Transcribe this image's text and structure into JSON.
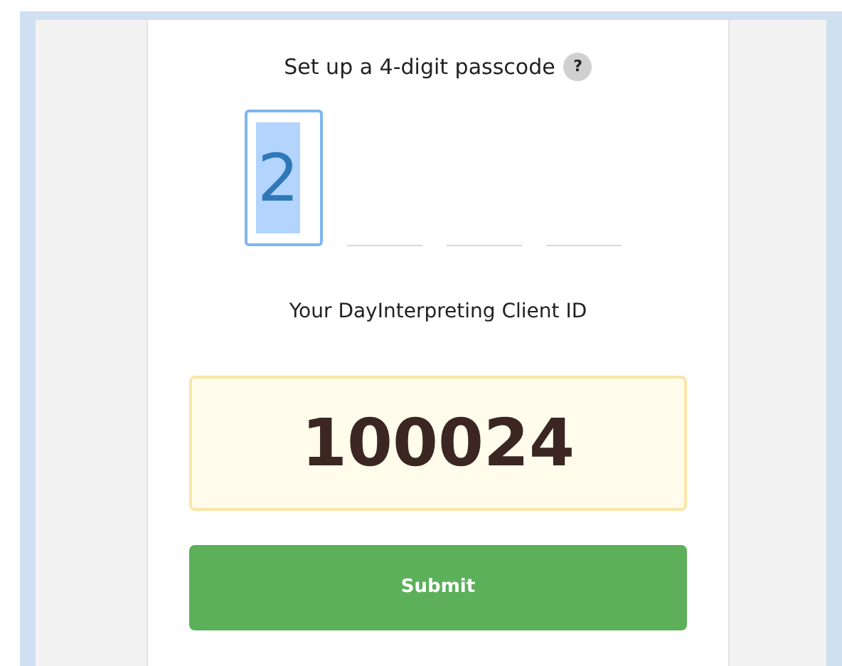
{
  "title": "Set up a 4-digit passcode",
  "help_icon": "?",
  "passcode_digits": [
    {
      "value": "2",
      "focused": true
    },
    {
      "focused": false
    },
    {
      "focused": false
    },
    {
      "focused": false
    }
  ],
  "client_id": {
    "label": "Your DayInterpreting Client ID",
    "value": "100024"
  },
  "submit_button": "Submit"
}
